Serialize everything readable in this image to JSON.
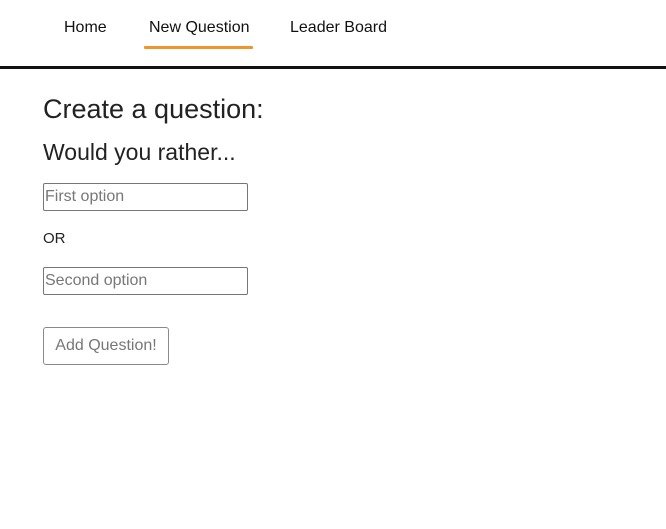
{
  "nav": {
    "items": [
      {
        "label": "Home",
        "active": false
      },
      {
        "label": "New Question",
        "active": true
      },
      {
        "label": "Leader Board",
        "active": false
      }
    ],
    "active_color": "#f0952d",
    "border_color": "#111111"
  },
  "form": {
    "title": "Create a question:",
    "subtitle": "Would you rather...",
    "first_option": {
      "value": "",
      "placeholder": "First option"
    },
    "or_label": "OR",
    "second_option": {
      "value": "",
      "placeholder": "Second option"
    },
    "submit_label": "Add Question!",
    "submit_disabled": true
  }
}
